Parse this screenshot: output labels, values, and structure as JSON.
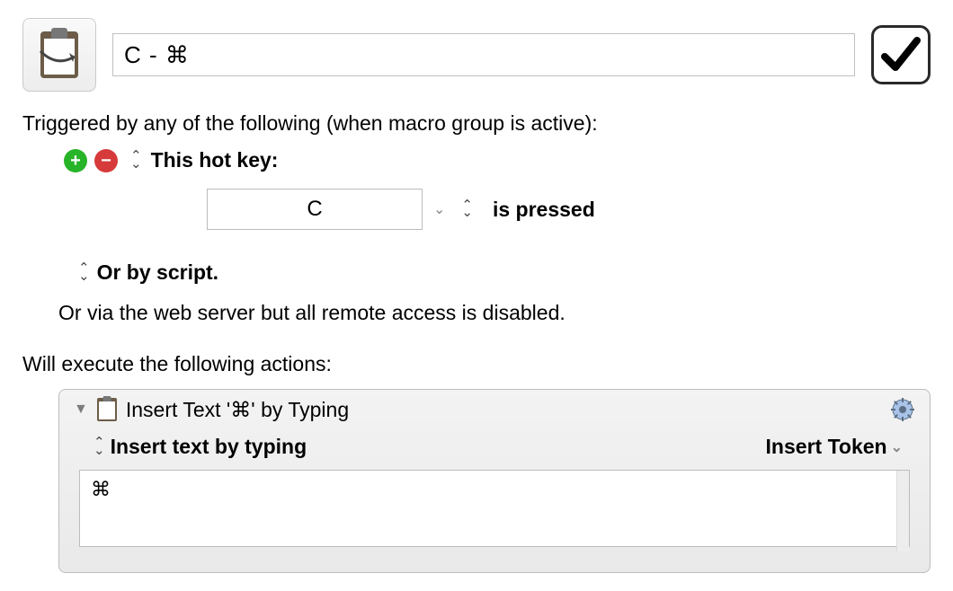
{
  "header": {
    "macro_name": "C - ⌘"
  },
  "triggers": {
    "heading": "Triggered by any of the following (when macro group is active):",
    "hotkey_label": "This hot key:",
    "hotkey_value": "C",
    "condition_label": "is pressed",
    "script_label": "Or by script.",
    "webserver_label": "Or via the web server but all remote access is disabled."
  },
  "actions": {
    "heading": "Will execute the following actions:",
    "item": {
      "title": "Insert Text '⌘' by Typing",
      "mode_label": "Insert text by typing",
      "token_label": "Insert Token",
      "text_value": "⌘"
    }
  }
}
